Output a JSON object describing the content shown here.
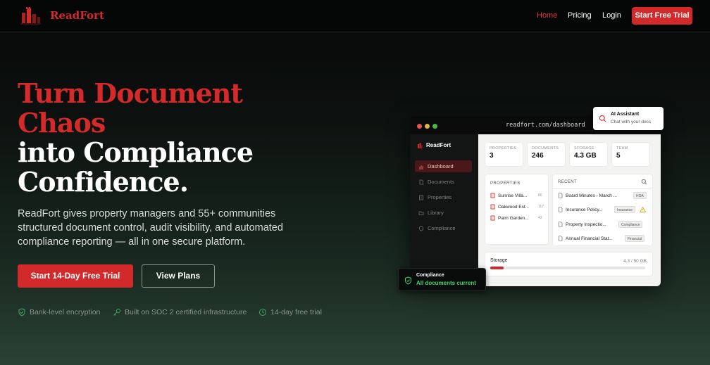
{
  "nav": {
    "brand": "ReadFort",
    "links": [
      "Home",
      "Pricing",
      "Login"
    ],
    "cta": "Start Free Trial"
  },
  "hero": {
    "title_red": [
      "Turn Document",
      "Chaos"
    ],
    "title_white": [
      "into Compliance",
      "Confidence."
    ],
    "subtitle": "ReadFort gives property managers and 55+ communities structured document control, audit visibility, and automated compliance reporting — all in one secure platform.",
    "primary_cta": "Start 14-Day Free Trial",
    "secondary_cta": "View Plans",
    "trust": [
      "Bank-level encryption",
      "Built on SOC 2 certified infrastructure",
      "14-day free trial"
    ]
  },
  "mockup": {
    "url": "readfort.com/dashboard",
    "brand": "ReadFort",
    "sidebar": [
      "Dashboard",
      "Documents",
      "Properties",
      "Library",
      "Compliance"
    ],
    "stats": [
      {
        "label": "PROPERTIES",
        "value": "3"
      },
      {
        "label": "DOCUMENTS",
        "value": "246"
      },
      {
        "label": "STORAGE",
        "value": "4.3 GB"
      },
      {
        "label": "TEAM",
        "value": "5"
      }
    ],
    "properties_title": "PROPERTIES",
    "properties": [
      {
        "name": "Sunrise Villa...",
        "count": "86"
      },
      {
        "name": "Oakwood Est...",
        "count": "117"
      },
      {
        "name": "Palm Garden...",
        "count": "43"
      }
    ],
    "recent_title": "RECENT",
    "recent": [
      {
        "name": "Board Minutes - March ...",
        "tag": "HOA"
      },
      {
        "name": "Insurance Policy...",
        "tag": "Insurance"
      },
      {
        "name": "Property Inspectio...",
        "tag": "Compliance"
      },
      {
        "name": "Annual Financial Stat...",
        "tag": "Financial"
      }
    ],
    "storage_label": "Storage",
    "storage_value": "4.3 / 50 GB",
    "storage_fraction": 0.086
  },
  "ai_card": {
    "title": "AI Assistant",
    "subtitle": "Chat with your docs"
  },
  "compliance_card": {
    "title": "Compliance",
    "status": "All documents current"
  },
  "colors": {
    "accent": "#d22a2a",
    "success": "#3fd76c"
  }
}
